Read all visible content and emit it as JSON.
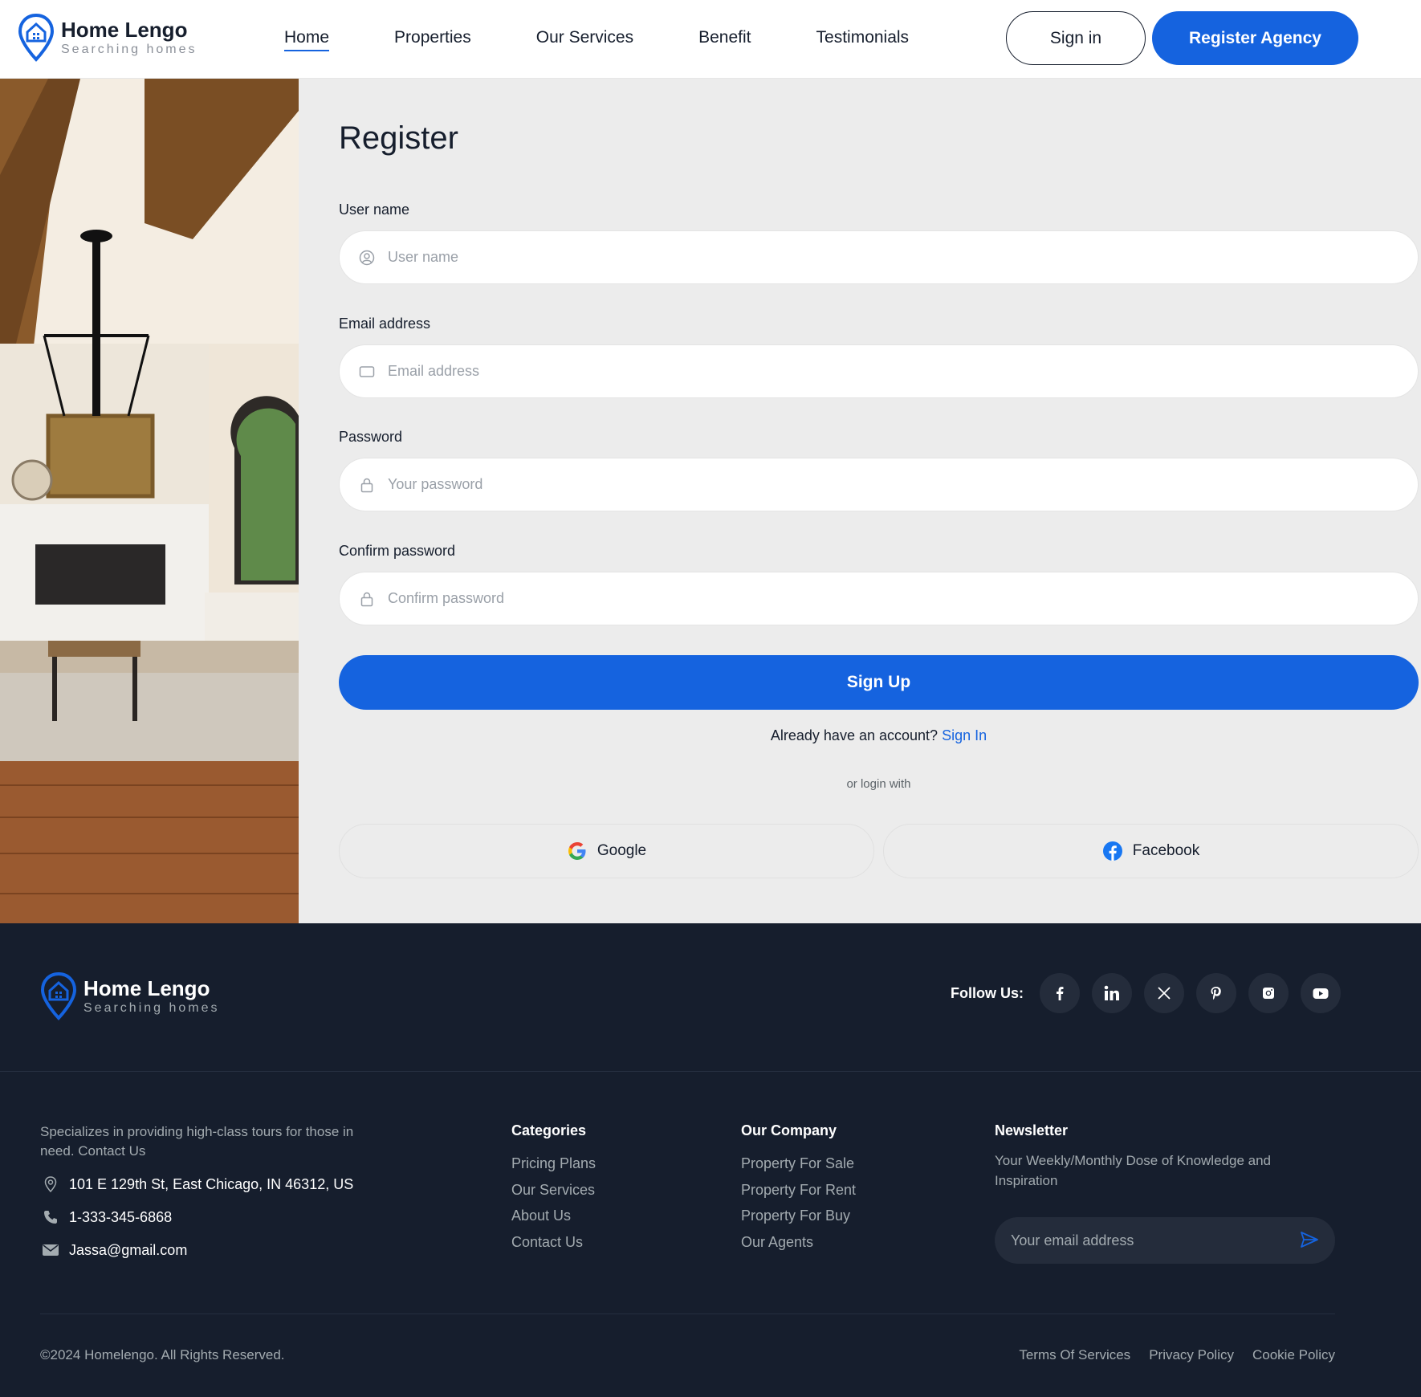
{
  "brand": {
    "name": "Home Lengo",
    "tagline": "Searching homes"
  },
  "nav": {
    "items": [
      "Home",
      "Properties",
      "Our Services",
      "Benefit",
      "Testimonials"
    ],
    "active": "Home",
    "signin_label": "Sign in",
    "register_label": "Register Agency"
  },
  "form": {
    "title": "Register",
    "username": {
      "label": "User name",
      "placeholder": "User name",
      "icon": "user-icon"
    },
    "email": {
      "label": "Email address",
      "placeholder": "Email address",
      "icon": "mail-icon"
    },
    "password": {
      "label": "Password",
      "placeholder": "Your password",
      "icon": "lock-icon"
    },
    "confirm": {
      "label": "Confirm password",
      "placeholder": "Confirm password",
      "icon": "lock-icon"
    },
    "submit_label": "Sign Up",
    "already_text": "Already have an account?",
    "signin_link": "Sign In",
    "or_text": "or login with",
    "google_label": "Google",
    "facebook_label": "Facebook"
  },
  "footer": {
    "follow_label": "Follow Us:",
    "socials": [
      "facebook-icon",
      "linkedin-icon",
      "x-icon",
      "pinterest-icon",
      "instagram-icon",
      "youtube-icon"
    ],
    "about": "Specializes in providing high-class tours for those in need. Contact Us",
    "address": "101 E 129th St, East Chicago, IN 46312, US",
    "phone": "1-333-345-6868",
    "email": "Jassa@gmail.com",
    "categories": {
      "title": "Categories",
      "links": [
        "Pricing Plans",
        "Our Services",
        "About Us",
        "Contact Us"
      ]
    },
    "company": {
      "title": "Our Company",
      "links": [
        "Property For Sale",
        "Property For Rent",
        "Property For Buy",
        "Our Agents"
      ]
    },
    "newsletter": {
      "title": "Newsletter",
      "desc": "Your Weekly/Monthly Dose of Knowledge and Inspiration",
      "placeholder": "Your email address"
    },
    "copyright": "©2024 Homelengo. All Rights Reserved.",
    "legal": [
      "Terms Of Services",
      "Privacy Policy",
      "Cookie Policy"
    ]
  },
  "colors": {
    "accent": "#1563df",
    "footer_bg": "#161e2d",
    "form_bg": "#ececec"
  }
}
